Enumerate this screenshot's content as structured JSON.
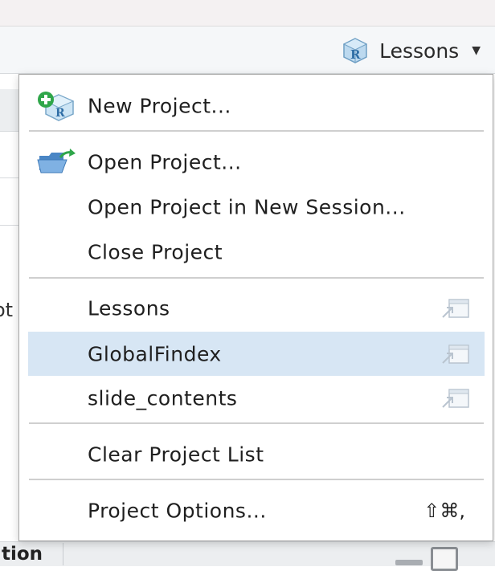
{
  "toolbar": {
    "project_label": "Lessons"
  },
  "background": {
    "clipped_text": "ot",
    "bottom_label": "tion"
  },
  "menu": {
    "items": [
      {
        "label": "New Project...",
        "icon": "new-project-icon"
      },
      {
        "label": "Open Project...",
        "icon": "open-folder-icon"
      },
      {
        "label": "Open Project in New Session..."
      },
      {
        "label": "Close Project"
      },
      {
        "label": "Lessons",
        "icon": "open-in-new-window-icon"
      },
      {
        "label": "GlobalFindex",
        "icon": "open-in-new-window-icon",
        "highlighted": true
      },
      {
        "label": "slide_contents",
        "icon": "open-in-new-window-icon"
      },
      {
        "label": "Clear Project List"
      },
      {
        "label": "Project Options...",
        "shortcut": "⇧⌘,"
      }
    ]
  },
  "colors": {
    "highlight": "#d7e6f4",
    "toolbar_bg": "#f5f7f9",
    "menu_border": "#a6a6a6"
  }
}
